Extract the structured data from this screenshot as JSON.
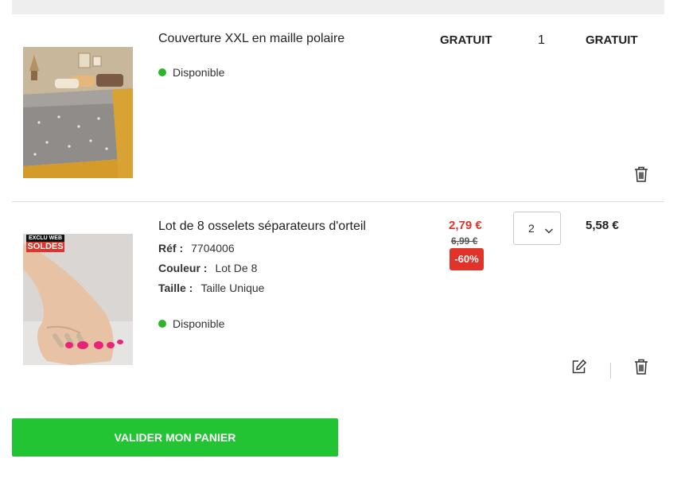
{
  "cart": {
    "items": [
      {
        "name": "Couverture XXL en maille polaire",
        "status": "Disponible",
        "unit_price": "GRATUIT",
        "quantity": "1",
        "total": "GRATUIT",
        "delete_icon": "trash-icon"
      },
      {
        "name": "Lot de 8 osselets séparateurs d'orteil",
        "badge_top": "EXCLU WEB",
        "badge_bottom": "SOLDES",
        "attributes": [
          {
            "label": "Réf :",
            "value": "7704006"
          },
          {
            "label": "Couleur :",
            "value": "Lot De 8"
          },
          {
            "label": "Taille :",
            "value": "Taille Unique"
          }
        ],
        "status": "Disponible",
        "price": "2,79 €",
        "old_price": "6,99 €",
        "discount": "-60%",
        "quantity": "2",
        "total": "5,58 €",
        "edit_icon": "edit-icon",
        "delete_icon": "trash-icon"
      }
    ]
  },
  "checkout": {
    "button_label": "VALIDER MON PANIER"
  },
  "colors": {
    "status_green": "#2bb52b",
    "sale_red": "#e0332a",
    "cta_green": "#23c433"
  }
}
